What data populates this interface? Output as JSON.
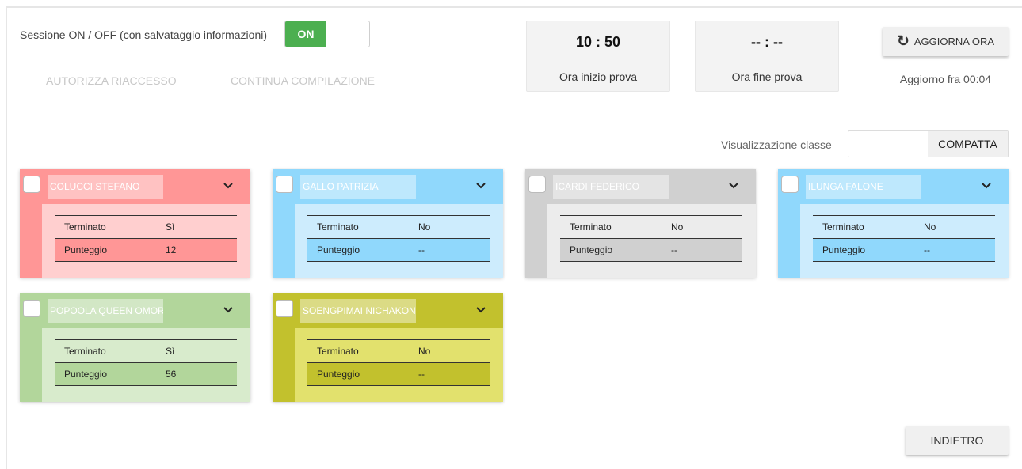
{
  "session": {
    "label": "Sessione ON / OFF (con salvataggio informazioni)",
    "toggle_label": "ON"
  },
  "actions": {
    "authorize_label": "AUTORIZZA RIACCESSO",
    "continue_label": "CONTINUA COMPILAZIONE"
  },
  "start_time": {
    "value": "10 : 50",
    "caption": "Ora inizio prova"
  },
  "end_time": {
    "value": "-- : --",
    "caption": "Ora fine prova"
  },
  "refresh": {
    "label": "AGGIORNA ORA",
    "icon": "refresh-icon",
    "countdown": "Aggiorno fra 00:04"
  },
  "view": {
    "label": "Visualizzazione classe",
    "option": "COMPATTA"
  },
  "row_labels": {
    "terminated": "Terminato",
    "score": "Punteggio"
  },
  "students": [
    {
      "name": "COLUCCI STEFANO",
      "terminated": "Sì",
      "score": "12",
      "colors": {
        "dark": "#ff9696",
        "light": "#ffcfcf"
      }
    },
    {
      "name": "GALLO PATRIZIA",
      "terminated": "No",
      "score": "--",
      "colors": {
        "dark": "#90d8fc",
        "light": "#cdecfd"
      }
    },
    {
      "name": "ICARDI FEDERICO",
      "terminated": "No",
      "score": "--",
      "colors": {
        "dark": "#d0d0d0",
        "light": "#ececec"
      }
    },
    {
      "name": "ILUNGA FALONE",
      "terminated": "No",
      "score": "--",
      "colors": {
        "dark": "#90d8fc",
        "light": "#cdecfd"
      }
    },
    {
      "name": "POPOOLA QUEEN OMOROWA",
      "terminated": "Sì",
      "score": "56",
      "colors": {
        "dark": "#b2d69b",
        "light": "#d8ebcc"
      }
    },
    {
      "name": "SOENGPIMAI NICHAKON",
      "terminated": "No",
      "score": "--",
      "colors": {
        "dark": "#c2c12d",
        "light": "#e2e16d"
      }
    }
  ],
  "back": {
    "label": "INDIETRO"
  }
}
